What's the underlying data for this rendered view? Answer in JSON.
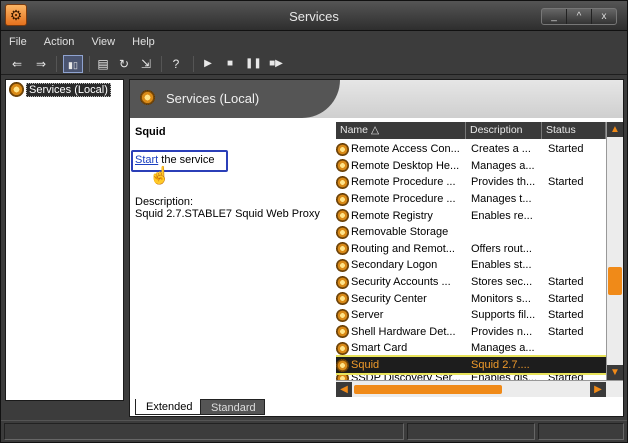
{
  "window": {
    "title": "Services"
  },
  "menu": {
    "items": [
      "File",
      "Action",
      "View",
      "Help"
    ]
  },
  "tree": {
    "root_label": "Services (Local)"
  },
  "header": {
    "title": "Services (Local)"
  },
  "detail": {
    "service_name": "Squid",
    "start_link": "Start",
    "start_suffix": " the service",
    "description_label": "Description:",
    "description_value": "Squid 2.7.STABLE7 Squid Web Proxy"
  },
  "list": {
    "columns": [
      "Name",
      "Description",
      "Status"
    ],
    "rows": [
      {
        "name": "Remote Access Con...",
        "description": "Creates a ...",
        "status": "Started"
      },
      {
        "name": "Remote Desktop He...",
        "description": "Manages a...",
        "status": ""
      },
      {
        "name": "Remote Procedure ...",
        "description": "Provides th...",
        "status": "Started"
      },
      {
        "name": "Remote Procedure ...",
        "description": "Manages t...",
        "status": ""
      },
      {
        "name": "Remote Registry",
        "description": "Enables re...",
        "status": ""
      },
      {
        "name": "Removable Storage",
        "description": "",
        "status": ""
      },
      {
        "name": "Routing and Remot...",
        "description": "Offers rout...",
        "status": ""
      },
      {
        "name": "Secondary Logon",
        "description": "Enables st...",
        "status": ""
      },
      {
        "name": "Security Accounts ...",
        "description": "Stores sec...",
        "status": "Started"
      },
      {
        "name": "Security Center",
        "description": "Monitors s...",
        "status": "Started"
      },
      {
        "name": "Server",
        "description": "Supports fil...",
        "status": "Started"
      },
      {
        "name": "Shell Hardware Det...",
        "description": "Provides n...",
        "status": "Started"
      },
      {
        "name": "Smart Card",
        "description": "Manages a...",
        "status": ""
      },
      {
        "name": "Squid",
        "description": "Squid 2.7....",
        "status": ""
      },
      {
        "name": "SSDP Discovery Ser...",
        "description": "Enables dis...",
        "status": "Started"
      }
    ],
    "selected_index": 13
  },
  "tabs": [
    "Extended",
    "Standard"
  ]
}
